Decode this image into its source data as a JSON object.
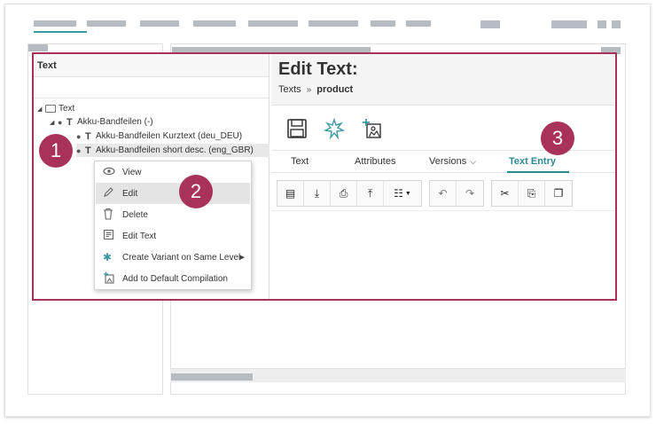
{
  "tree": {
    "header": "Text",
    "items": [
      {
        "label": "Text",
        "level": 0
      },
      {
        "label": "Akku-Bandfeilen (-)",
        "level": 1
      },
      {
        "label": "Akku-Bandfeilen Kurztext (deu_DEU)",
        "level": 2
      },
      {
        "label": "Akku-Bandfeilen short desc. (eng_GBR)",
        "level": 2
      }
    ]
  },
  "context_menu": {
    "items": [
      {
        "label": "View",
        "icon": "eye-icon"
      },
      {
        "label": "Edit",
        "icon": "pencil-icon"
      },
      {
        "label": "Delete",
        "icon": "trash-icon"
      },
      {
        "label": "Edit Text",
        "icon": "edit-text-icon"
      },
      {
        "label": "Create Variant on Same Level",
        "icon": "gear-icon"
      },
      {
        "label": "Add to Default Compilation",
        "icon": "add-compilation-icon"
      }
    ]
  },
  "editor": {
    "title": "Edit Text:",
    "breadcrumb": {
      "parent": "Texts",
      "separator": "»",
      "current": "product"
    },
    "actions": [
      "save-icon",
      "magic-icon",
      "add-compilation-icon"
    ],
    "tabs": [
      {
        "label": "Text"
      },
      {
        "label": "Attributes"
      },
      {
        "label": "Versions"
      },
      {
        "label": "Text Entry",
        "active": true
      }
    ]
  },
  "badges": [
    "1",
    "2",
    "3"
  ],
  "colors": {
    "accent": "#a8325a",
    "teal": "#2d8a92"
  }
}
